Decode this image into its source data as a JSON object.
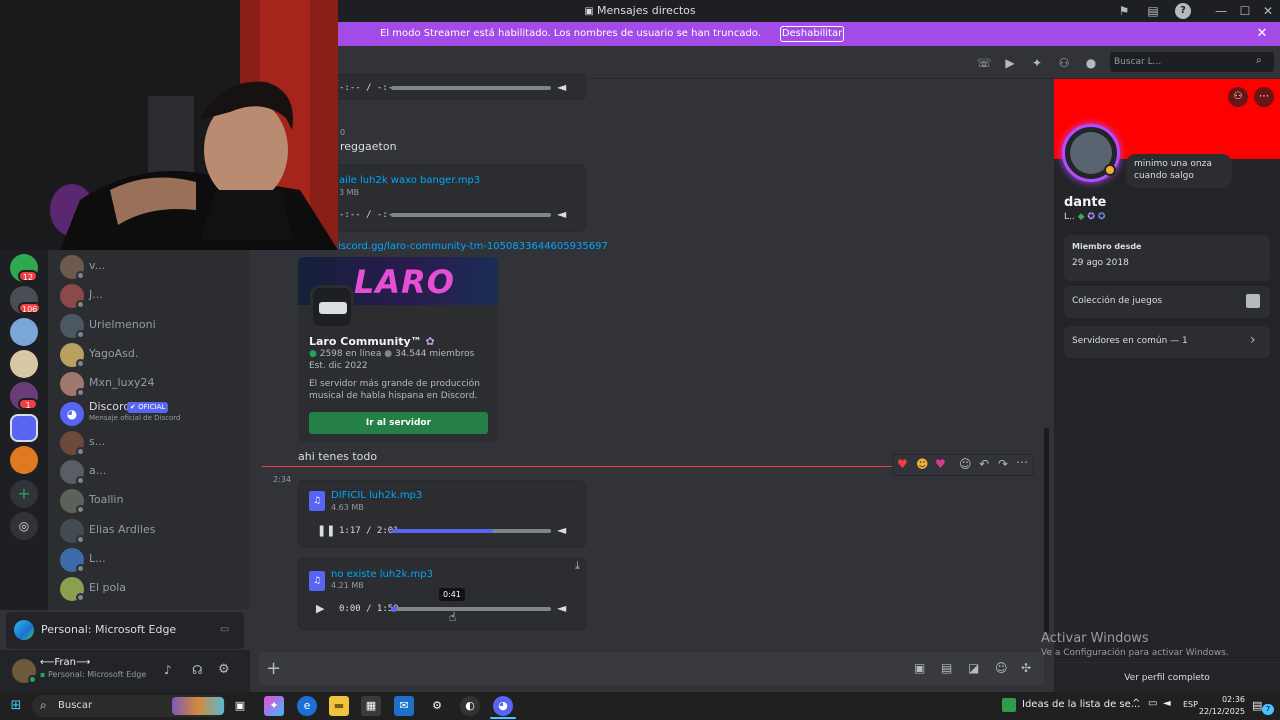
{
  "window": {
    "title": "Mensajes directos"
  },
  "banner": {
    "text": "El modo Streamer está habilitado. Los nombres de usuario se han truncado.",
    "button": "Deshabilitar"
  },
  "search": {
    "placeholder": "Buscar L..."
  },
  "servers": [
    {
      "badge": "12",
      "color": "#2fa84f"
    },
    {
      "badge": "106",
      "color": "#4a4d55"
    },
    {
      "badge": "",
      "color": "#7aa6d8"
    },
    {
      "badge": "",
      "color": "#d8c7a5"
    },
    {
      "badge": "1",
      "color": "#6a3d7a"
    },
    {
      "badge": "",
      "color": "#5865f2"
    },
    {
      "badge": "",
      "color": "#e07a22"
    }
  ],
  "dms": [
    {
      "name": "v...",
      "color": "#6d5a4d"
    },
    {
      "name": "J...",
      "color": "#8a4a4a"
    },
    {
      "name": "Urielmenoni",
      "color": "#4d5663"
    },
    {
      "name": "YagoAsd.",
      "color": "#b8a060"
    },
    {
      "name": "Mxn_luxy24",
      "color": "#a07870"
    },
    {
      "name": "Discord",
      "color": "#5865f2",
      "badge": "✔ OFICIAL",
      "sub": "Mensaje oficial de Discord"
    },
    {
      "name": "s...",
      "color": "#6b4a3c"
    },
    {
      "name": "a...",
      "color": "#5a5d63"
    },
    {
      "name": "Toallin",
      "color": "#5d6258"
    },
    {
      "name": "Elias Ardiles",
      "color": "#444a52"
    },
    {
      "name": "L...",
      "color": "#3d6aa8"
    },
    {
      "name": "El pola",
      "color": "#8aa050"
    }
  ],
  "edge_card": {
    "label": "Personal: Microsoft Edge"
  },
  "user": {
    "name": "⟵Fran⟶",
    "status": "Personal: Microsoft Edge"
  },
  "messages": {
    "top_audio": {
      "time": "-:-- / -:--"
    },
    "stamp_partial": "0",
    "reggaeton_text": "reggaeton",
    "audio2": {
      "name": "aile luh2k waxo banger.mp3",
      "size": "3 MB",
      "time": "-:-- / -:--"
    },
    "invite_link": "iscord.gg/laro-community-tm-1050833644605935697",
    "invite": {
      "banner_text": "LARO",
      "name": "Laro Community™",
      "online": "2598 en línea",
      "members": "34.544 miembros",
      "est": "Est. dic 2022",
      "description": "El servidor más grande de producción musical de habla hispana en Discord.",
      "button": "Ir al servidor"
    },
    "ahi_text": "ahi tenes todo",
    "timestamp": "2:34",
    "file1": {
      "name": "DIFICIL luh2k.mp3",
      "size": "4.63 MB",
      "time": "1:17 / 2:01",
      "progress": 0.64
    },
    "file2": {
      "name": "no existe luh2k.mp3",
      "size": "4.21 MB",
      "time": "0:00 / 1:50",
      "progress": 0.0,
      "tooltip": "0:41"
    }
  },
  "profile": {
    "bio": "minimo una onza cuando salgo",
    "name": "dante",
    "tag": "L..",
    "member_since_label": "Miembro desde",
    "member_since": "29 ago 2018",
    "games": "Colección de juegos",
    "common": "Servidores en común — 1",
    "view_full": "Ver perfil completo",
    "banner_color": "#ff0000"
  },
  "watermark": {
    "title": "Activar Windows",
    "sub": "Ve a Configuración para activar Windows."
  },
  "taskbar": {
    "search": "Buscar",
    "notification": "Ideas de la lista de se...",
    "lang": "ESP",
    "time": "02:36",
    "date": "22/12/2025",
    "badge": "7"
  }
}
